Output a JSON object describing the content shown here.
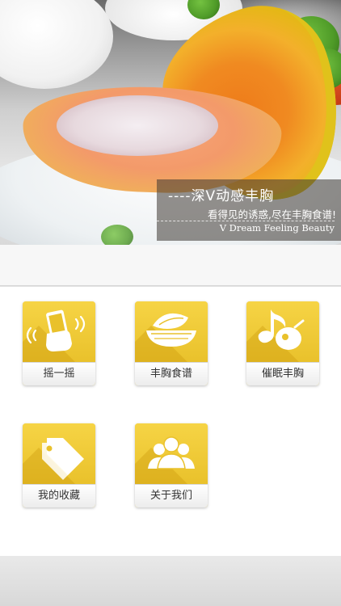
{
  "banner": {
    "title": "----深V动感丰胸",
    "subtitle": "看得见的诱惑,尽在丰胸食谱!",
    "english": "V  Dream Feeling Beauty"
  },
  "menu": [
    {
      "label": "摇一摇",
      "icon": "shake-phone-icon"
    },
    {
      "label": "丰胸食谱",
      "icon": "salad-bowl-icon"
    },
    {
      "label": "催眠丰胸",
      "icon": "music-note-icon"
    },
    {
      "label": "我的收藏",
      "icon": "tag-icon"
    },
    {
      "label": "关于我们",
      "icon": "people-icon"
    }
  ],
  "colors": {
    "tile": "#f3cf3e",
    "tile_shadow": "#c8960a",
    "panel": "#ffffff",
    "background": "#f2f2f2"
  }
}
